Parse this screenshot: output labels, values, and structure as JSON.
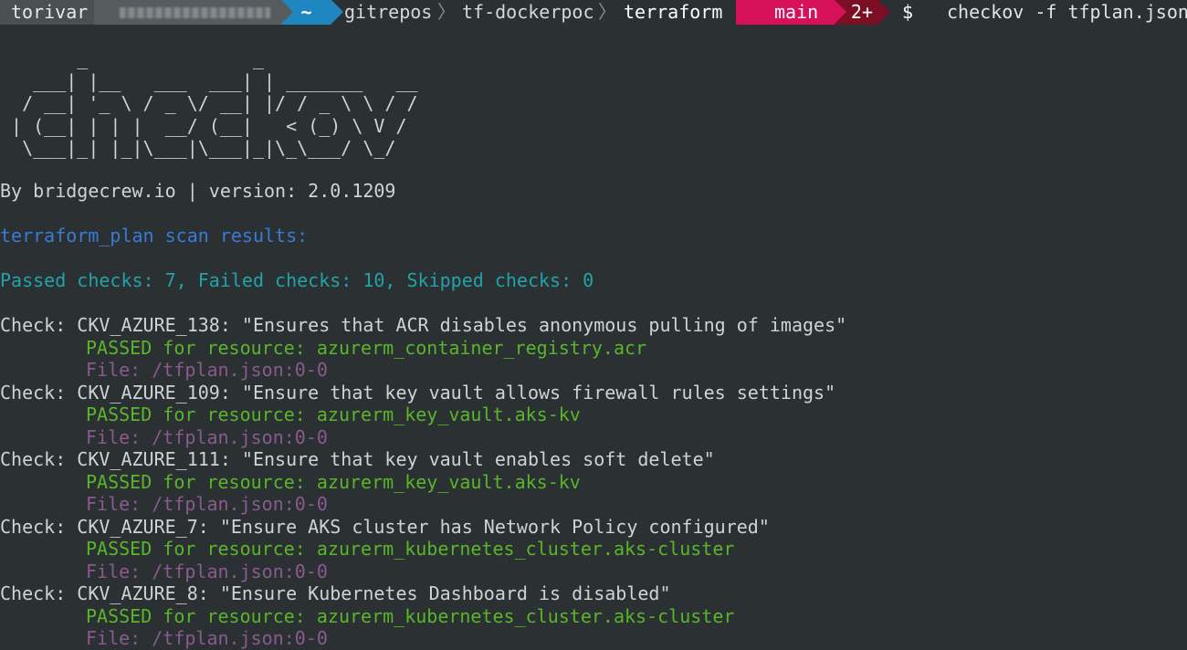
{
  "prompt": {
    "user": "torivar",
    "tilde": "~",
    "path": [
      "gitrepos",
      "tf-dockerpoc",
      "terraform"
    ],
    "path_sep": "〉",
    "branch_icon": "",
    "branch": "main",
    "dirty": "2+",
    "dollar": "$",
    "command": "checkov -f tfplan.json"
  },
  "banner": "       _               _\n   ___| |__   ___  ___| | _______   __\n  / __| '_ \\ / _ \\/ __| |/ / _ \\ \\ / /\n | (__| | | |  __/ (__|   < (_) \\ V /\n  \\___|_| |_|\\___|\\___|_|\\_\\___/ \\_/",
  "byline": "By bridgecrew.io | version: 2.0.1209",
  "scan_header": "terraform_plan scan results:",
  "summary": "Passed checks: 7, Failed checks: 10, Skipped checks: 0",
  "checks": [
    {
      "check": "Check: CKV_AZURE_138: \"Ensures that ACR disables anonymous pulling of images\"",
      "passed": "PASSED for resource: azurerm_container_registry.acr",
      "file": "File: /tfplan.json:0-0"
    },
    {
      "check": "Check: CKV_AZURE_109: \"Ensure that key vault allows firewall rules settings\"",
      "passed": "PASSED for resource: azurerm_key_vault.aks-kv",
      "file": "File: /tfplan.json:0-0"
    },
    {
      "check": "Check: CKV_AZURE_111: \"Ensure that key vault enables soft delete\"",
      "passed": "PASSED for resource: azurerm_key_vault.aks-kv",
      "file": "File: /tfplan.json:0-0"
    },
    {
      "check": "Check: CKV_AZURE_7: \"Ensure AKS cluster has Network Policy configured\"",
      "passed": "PASSED for resource: azurerm_kubernetes_cluster.aks-cluster",
      "file": "File: /tfplan.json:0-0"
    },
    {
      "check": "Check: CKV_AZURE_8: \"Ensure Kubernetes Dashboard is disabled\"",
      "passed": "PASSED for resource: azurerm_kubernetes_cluster.aks-cluster",
      "file": "File: /tfplan.json:0-0"
    }
  ],
  "colors": {
    "background": "#2b3033",
    "text": "#cfd3d4",
    "blue": "#3a7bd5",
    "cyan": "#21a3a8",
    "green": "#5ab52a",
    "purple": "#8a5a8f",
    "tilde_segment": "#1f87bf",
    "branch_segment": "#d6115a",
    "dirty_segment": "#7d0f25"
  }
}
